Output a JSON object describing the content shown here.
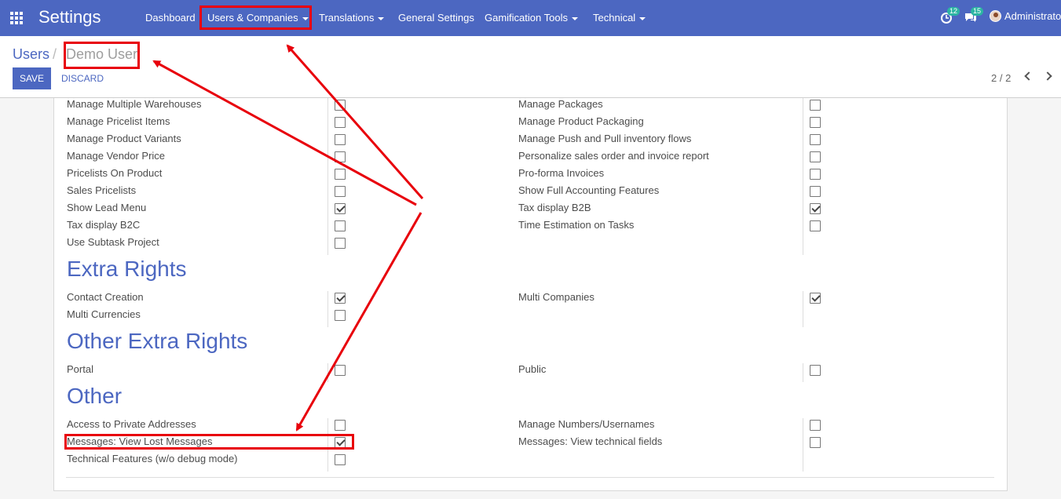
{
  "app": {
    "title": "Settings"
  },
  "nav": {
    "dashboard": "Dashboard",
    "users_companies": "Users & Companies",
    "translations": "Translations",
    "general_settings": "General Settings",
    "gamification": "Gamification Tools",
    "technical": "Technical"
  },
  "systray": {
    "activity_count": "12",
    "messages_count": "15",
    "user": "Administrato"
  },
  "breadcrumb": {
    "parent": "Users",
    "separator": "/",
    "current": "Demo User"
  },
  "buttons": {
    "save": "SAVE",
    "discard": "DISCARD"
  },
  "pager": {
    "value": "2 / 2"
  },
  "rights": {
    "left": [
      {
        "label": "Manage Multiple Warehouses",
        "checked": false
      },
      {
        "label": "Manage Pricelist Items",
        "checked": false
      },
      {
        "label": "Manage Product Variants",
        "checked": false
      },
      {
        "label": "Manage Vendor Price",
        "checked": false
      },
      {
        "label": "Pricelists On Product",
        "checked": false
      },
      {
        "label": "Sales Pricelists",
        "checked": false
      },
      {
        "label": "Show Lead Menu",
        "checked": true
      },
      {
        "label": "Tax display B2C",
        "checked": false
      },
      {
        "label": "Use Subtask Project",
        "checked": false
      }
    ],
    "right": [
      {
        "label": "Manage Packages",
        "checked": false
      },
      {
        "label": "Manage Product Packaging",
        "checked": false
      },
      {
        "label": "Manage Push and Pull inventory flows",
        "checked": false
      },
      {
        "label": "Personalize sales order and invoice report",
        "checked": false
      },
      {
        "label": "Pro-forma Invoices",
        "checked": false
      },
      {
        "label": "Show Full Accounting Features",
        "checked": false
      },
      {
        "label": "Tax display B2B",
        "checked": true
      },
      {
        "label": "Time Estimation on Tasks",
        "checked": false
      }
    ]
  },
  "extra_rights": {
    "title": "Extra Rights",
    "left": [
      {
        "label": "Contact Creation",
        "checked": true
      },
      {
        "label": "Multi Currencies",
        "checked": false
      }
    ],
    "right": [
      {
        "label": "Multi Companies",
        "checked": true
      }
    ]
  },
  "other_extra_rights": {
    "title": "Other Extra Rights",
    "left": [
      {
        "label": "Portal",
        "checked": false
      }
    ],
    "right": [
      {
        "label": "Public",
        "checked": false
      }
    ]
  },
  "other": {
    "title": "Other",
    "left": [
      {
        "label": "Access to Private Addresses",
        "checked": false
      },
      {
        "label": "Messages: View Lost Messages",
        "checked": true
      },
      {
        "label": "Technical Features (w/o debug mode)",
        "checked": false
      }
    ],
    "right": [
      {
        "label": "Manage Numbers/Usernames",
        "checked": false
      },
      {
        "label": "Messages: View technical fields",
        "checked": false
      }
    ]
  },
  "colors": {
    "brand": "#4c67c1",
    "annotation": "#e8000b"
  }
}
